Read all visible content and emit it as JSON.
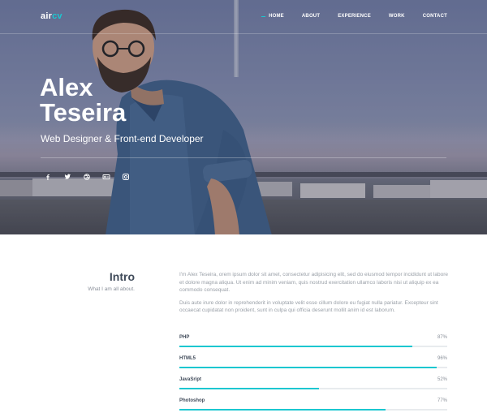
{
  "brand": {
    "logo_main": "air",
    "logo_accent": "cv"
  },
  "nav": {
    "items": [
      "HOME",
      "ABOUT",
      "EXPERIENCE",
      "WORK",
      "CONTACT"
    ],
    "active": "HOME"
  },
  "hero": {
    "name_line1": "Alex",
    "name_line2": "Teseira",
    "subtitle": "Web Designer & Front-end Developer",
    "socials": [
      "facebook-icon",
      "twitter-icon",
      "dribbble-icon",
      "behance-icon",
      "instagram-icon"
    ]
  },
  "intro": {
    "title": "Intro",
    "tagline": "What I am all about.",
    "paragraph1": "I'm Alex Teseira, orem ipsum dolor sit amet, consectetur adipisicing elit, sed do eiusmod tempor incididunt ut labore et dolore magna aliqua. Ut enim ad minim veniam, quis nostrud exercitation ullamco laboris nisi ut aliquip ex ea commodo consequat.",
    "paragraph2": "Duis aute irure dolor in reprehenderit in voluptate velit esse cillum dolore eu fugiat nulla pariatur. Excepteur sint occaecat cupidatat non proident, sunt in culpa qui officia deserunt mollit anim id est laborum."
  },
  "skills": [
    {
      "name": "PHP",
      "percent_label": "87%",
      "value": 87
    },
    {
      "name": "HTML5",
      "percent_label": "96%",
      "value": 96
    },
    {
      "name": "JavaSript",
      "percent_label": "52%",
      "value": 52
    },
    {
      "name": "Photoshop",
      "percent_label": "77%",
      "value": 77
    }
  ],
  "colors": {
    "accent": "#1cc7d0",
    "heading": "#404b5a",
    "body_text": "#9aa0a8"
  }
}
